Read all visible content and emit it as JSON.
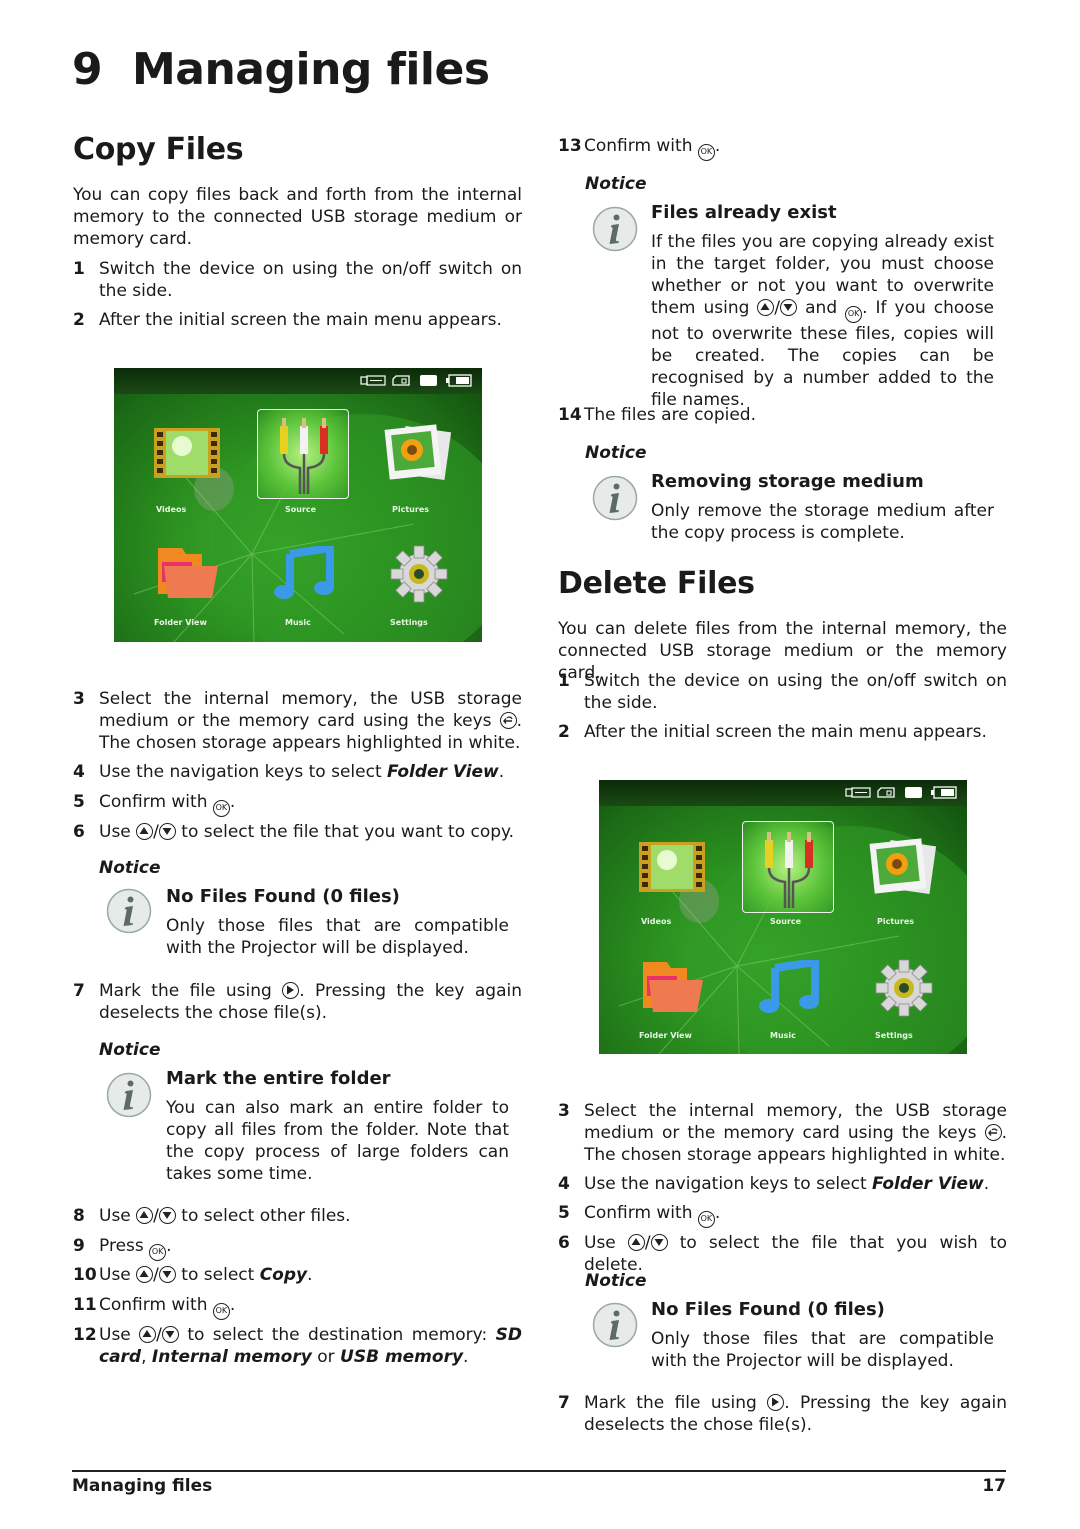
{
  "chapter": {
    "number": "9",
    "title": "Managing files"
  },
  "copy_section": {
    "heading": "Copy Files",
    "intro": "You can copy files back and forth from the internal memory to the connected USB storage medium or memory card.",
    "steps": {
      "s1": {
        "n": "1",
        "text": "Switch the device on using the on/off switch on the side."
      },
      "s2": {
        "n": "2",
        "text": "After the initial screen the main menu appears."
      },
      "s3": {
        "n": "3",
        "pre": "Select the internal memory, the USB storage medium or the memory card using the keys ",
        "post": ". The chosen storage appears highlighted in white."
      },
      "s4": {
        "n": "4",
        "pre": "Use the navigation keys to select ",
        "em": "Folder View",
        "post": "."
      },
      "s5": {
        "n": "5",
        "pre": "Confirm with ",
        "post": "."
      },
      "s6": {
        "n": "6",
        "pre": "Use ",
        "post": " to select the file that you want to copy."
      },
      "s7": {
        "n": "7",
        "pre": "Mark the file using ",
        "post": ". Pressing the key again deselects the chose file(s)."
      },
      "s8": {
        "n": "8",
        "pre": "Use ",
        "post": " to select other files."
      },
      "s9": {
        "n": "9",
        "pre": "Press ",
        "post": "."
      },
      "s10": {
        "n": "10",
        "pre": "Use ",
        "mid": " to select ",
        "em": "Copy",
        "post": "."
      },
      "s11": {
        "n": "11",
        "pre": "Confirm with ",
        "post": "."
      },
      "s12": {
        "n": "12",
        "pre": "Use ",
        "mid": " to select the destination memory: ",
        "em1": "SD card",
        "sep1": ", ",
        "em2": "Internal memory",
        "sep2": " or ",
        "em3": "USB memory",
        "post": "."
      },
      "s13": {
        "n": "13",
        "pre": "Confirm with ",
        "post": "."
      },
      "s14": {
        "n": "14",
        "text": "The files are copied."
      }
    },
    "notices": {
      "no_files": {
        "label": "Notice",
        "title": "No Files Found (0 files)",
        "body": "Only those files that are compatible with the Projector will be displayed."
      },
      "mark_folder": {
        "label": "Notice",
        "title": "Mark the entire folder",
        "body": "You can also mark an entire folder to copy all files from the folder. Note that the copy process of large folders can takes some time."
      },
      "files_exist": {
        "label": "Notice",
        "title": "Files already exist",
        "pre": "If the files you are copying already exist in the target folder, you must choose whether or not you want to overwrite them using ",
        "mid": " and ",
        "post": ". If you choose not to overwrite these files, copies will be created. The copies can be recognised by a number added to the file names."
      },
      "removing": {
        "label": "Notice",
        "title": "Removing storage medium",
        "body": "Only remove the storage medium after the copy process is complete."
      }
    }
  },
  "delete_section": {
    "heading": "Delete Files",
    "intro": "You can delete files from the internal memory, the connected USB storage medium or the memory card.",
    "steps": {
      "s1": {
        "n": "1",
        "text": "Switch the device on using the on/off switch on the side."
      },
      "s2": {
        "n": "2",
        "text": "After the initial screen the main menu appears."
      },
      "s3": {
        "n": "3",
        "pre": "Select the internal memory, the USB storage medium or the memory card using the keys ",
        "post": ". The chosen storage appears highlighted in white."
      },
      "s4": {
        "n": "4",
        "pre": "Use the navigation keys to select ",
        "em": "Folder View",
        "post": "."
      },
      "s5": {
        "n": "5",
        "pre": "Confirm with ",
        "post": "."
      },
      "s6": {
        "n": "6",
        "pre": "Use ",
        "post": " to select the file that you wish to delete."
      },
      "s7": {
        "n": "7",
        "pre": "Mark the file using ",
        "post": ". Pressing the key again deselects the chose file(s)."
      }
    },
    "notices": {
      "no_files": {
        "label": "Notice",
        "title": "No Files Found (0 files)",
        "body": "Only those files that are compatible with the Projector will be displayed."
      }
    }
  },
  "device_menu": {
    "status_icons": [
      "usb-icon",
      "sd-card-icon",
      "internal-memory-icon",
      "battery-icon"
    ],
    "selected": "Source",
    "items": [
      {
        "label": "Videos",
        "icon": "film-icon"
      },
      {
        "label": "Source",
        "icon": "av-cable-icon"
      },
      {
        "label": "Pictures",
        "icon": "photo-icon"
      },
      {
        "label": "Folder View",
        "icon": "folder-icon"
      },
      {
        "label": "Music",
        "icon": "music-note-icon"
      },
      {
        "label": "Settings",
        "icon": "gear-icon"
      }
    ]
  },
  "keys": {
    "ok": "OK",
    "slash": "/"
  },
  "footer": {
    "section": "Managing files",
    "page": "17"
  }
}
